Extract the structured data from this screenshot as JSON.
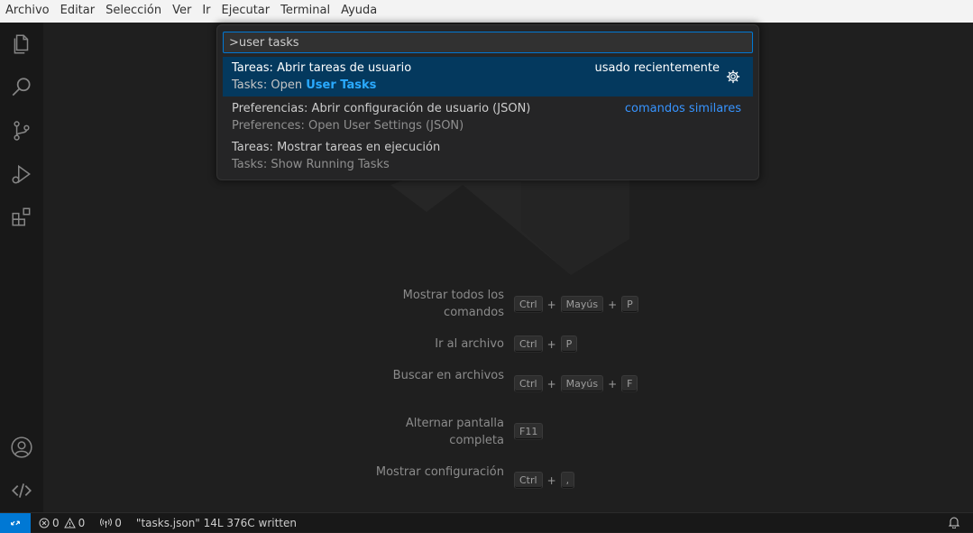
{
  "menu": [
    "Archivo",
    "Editar",
    "Selección",
    "Ver",
    "Ir",
    "Ejecutar",
    "Terminal",
    "Ayuda"
  ],
  "activity_bar": {
    "icons": [
      "files-icon",
      "search-icon",
      "source-control-icon",
      "run-debug-icon",
      "extensions-icon"
    ],
    "bottom_icons": [
      "account-icon",
      "remote-explorer-icon"
    ]
  },
  "palette": {
    "input_value": ">user tasks",
    "results": [
      {
        "label": "Tareas: Abrir tareas de usuario",
        "detail_prefix": "Tasks: Open ",
        "detail_highlight": "User Tasks",
        "tag": "usado recientemente",
        "selected": true
      },
      {
        "label": "Preferencias: Abrir configuración de usuario (JSON)",
        "detail": "Preferences: Open User Settings (JSON)",
        "tag": "comandos similares"
      },
      {
        "label": "Tareas: Mostrar tareas en ejecución",
        "detail": "Tasks: Show Running Tasks"
      }
    ]
  },
  "shortcuts": [
    {
      "label": "Mostrar todos los comandos",
      "keys": [
        "Ctrl",
        "Mayús",
        "P"
      ]
    },
    {
      "label": "Ir al archivo",
      "keys": [
        "Ctrl",
        "P"
      ]
    },
    {
      "label": "Buscar en archivos",
      "keys": [
        "Ctrl",
        "Mayús",
        "F"
      ]
    },
    {
      "label": "Alternar pantalla completa",
      "keys": [
        "F11"
      ]
    },
    {
      "label": "Mostrar configuración",
      "keys": [
        "Ctrl",
        ","
      ]
    }
  ],
  "key_plus": "+",
  "status": {
    "errors": "0",
    "warnings": "0",
    "ports": "0",
    "message": "\"tasks.json\" 14L 376C written"
  },
  "colors": {
    "accent": "#0078d4",
    "selection": "#04395e",
    "highlight": "#2aaaff",
    "link": "#3794ff"
  }
}
